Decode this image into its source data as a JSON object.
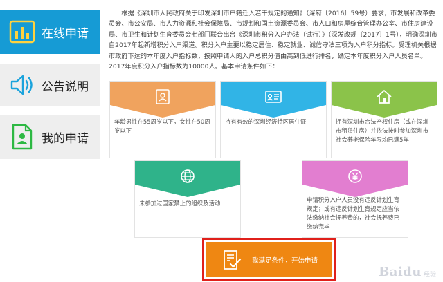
{
  "sidebar": {
    "items": [
      {
        "label": "在线申请",
        "icon": "bar-chart-icon",
        "active": true
      },
      {
        "label": "公告说明",
        "icon": "speaker-icon",
        "active": false
      },
      {
        "label": "我的申请",
        "icon": "user-document-icon",
        "active": false
      }
    ]
  },
  "intro": {
    "text": "根据《深圳市人民政府关于印发深圳市户籍迁入若干规定的通知》（深府〔2016〕59号）要求，市发展和改革委员会、市公安局、市人力资源和社会保障局、市规划和国土资源委员会、市人口和房屋综合管理办公室、市住房建设局、市卫生和计划生育委员会七部门联合出台《深圳市积分入户办法（试行）》（深发改规〔2017〕1号），明确深圳市自2017年起新增积分入户渠道。积分入户主要以稳定居住、稳定就业、诚信守法三项为入户积分指标。受理机关根据市政府下达的本年度入户指标数，按照申请人的入户总积分值由高到低进行排名，确定本年度积分入户人员名单。2017年度积分入户指标数为10000人。基本申请条件如下："
  },
  "conditions": [
    {
      "text": "年龄男性在55周岁以下，女性在50周岁以下",
      "icon": "id-card-icon",
      "color": "#f0a35e"
    },
    {
      "text": "持有有效的深圳经济特区居住证",
      "icon": "residence-card-icon",
      "color": "#31b4e6"
    },
    {
      "text": "拥有深圳市合法产权住房（或在深圳市租赁住房）并依法按时参加深圳市社会养老保险年限均已满5年",
      "icon": "house-icon",
      "color": "#8bc34a"
    },
    {
      "text": "未参加过国家禁止的组织及活动",
      "icon": "globe-icon",
      "color": "#2fb38a"
    },
    {
      "text": "申请积分入户人员没有违反计划生育规定；或有违反计划生育规定应当依法缴纳社会抚养费的，社会抚养费已缴纳完毕",
      "icon": "yuan-coin-icon",
      "color": "#e27ed0"
    }
  ],
  "apply_button": {
    "label": "我满足条件，开始申请",
    "icon": "checklist-icon",
    "color": "#ef8712"
  },
  "watermark": {
    "text": "Baidu",
    "sub": "经验"
  }
}
